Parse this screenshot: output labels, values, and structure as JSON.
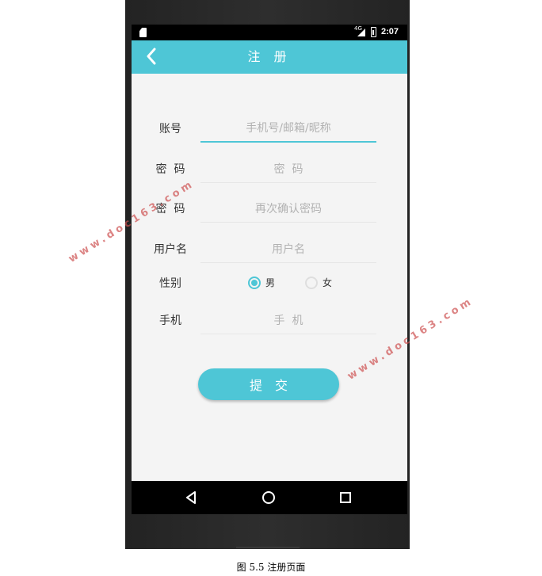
{
  "status_bar": {
    "network": "4G",
    "time": "2:07"
  },
  "app_bar": {
    "title": "注 册",
    "back_icon": "chevron-left-icon"
  },
  "form": {
    "account": {
      "label": "账号",
      "placeholder": "手机号/邮箱/昵称"
    },
    "password": {
      "label": "密  码",
      "placeholder": "密  码"
    },
    "confirm_password": {
      "label": "密  码",
      "placeholder": "再次确认密码"
    },
    "username": {
      "label": "用户名",
      "placeholder": "用户名"
    },
    "gender": {
      "label": "性别",
      "options": [
        "男",
        "女"
      ],
      "selected": "男"
    },
    "phone": {
      "label": "手机",
      "placeholder": "手  机"
    }
  },
  "submit_label": "提交",
  "nav_bar": {
    "icons": [
      "back-triangle-icon",
      "home-circle-icon",
      "recents-square-icon"
    ]
  },
  "caption": "图 5.5 注册页面",
  "watermark": "www.doc163.com",
  "colors": {
    "accent": "#4ec6d6",
    "screen_bg": "#f4f4f4",
    "bezel": "#2a2a2a"
  }
}
